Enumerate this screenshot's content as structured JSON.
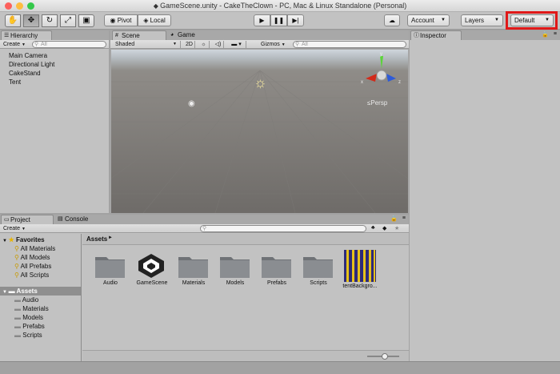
{
  "window": {
    "title": "GameScene.unity - CakeTheClown - PC, Mac & Linux Standalone (Personal)"
  },
  "toolbar": {
    "pivot_label": "Pivot",
    "local_label": "Local",
    "account_label": "Account",
    "layers_label": "Layers",
    "layout_label": "Default",
    "highlight_color": "#e01818"
  },
  "hierarchy": {
    "tab_label": "Hierarchy",
    "create_label": "Create",
    "search_placeholder": "All",
    "items": [
      "Main Camera",
      "Directional Light",
      "CakeStand",
      "Tent"
    ]
  },
  "scene": {
    "tab_label": "Scene",
    "game_tab_label": "Game",
    "shading_label": "Shaded",
    "mode_2d_label": "2D",
    "gizmos_label": "Gizmos",
    "search_placeholder": "All",
    "persp_label": "Persp",
    "axis_x": "x",
    "axis_y": "y",
    "axis_z": "z"
  },
  "inspector": {
    "tab_label": "Inspector"
  },
  "project": {
    "tab_label": "Project",
    "console_tab_label": "Console",
    "create_label": "Create",
    "favorites_label": "Favorites",
    "favorites": [
      "All Materials",
      "All Models",
      "All Prefabs",
      "All Scripts"
    ],
    "assets_label": "Assets",
    "asset_folders": [
      "Audio",
      "Materials",
      "Models",
      "Prefabs",
      "Scripts"
    ],
    "breadcrumb": "Assets",
    "grid_items": [
      "Audio",
      "GameScene",
      "Materials",
      "Models",
      "Prefabs",
      "Scripts",
      "tentBackgro..."
    ]
  }
}
